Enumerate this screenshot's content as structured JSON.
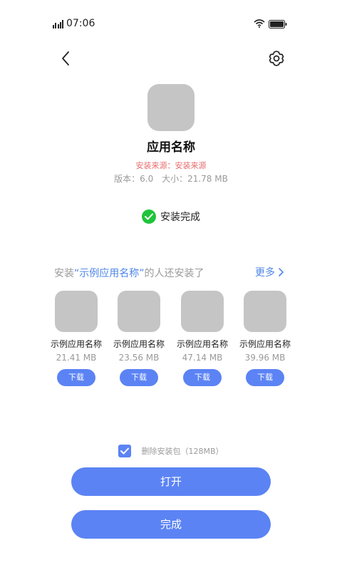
{
  "status_bar": {
    "time": "07:06"
  },
  "app": {
    "name": "应用名称",
    "install_source": "安装来源：安装来源",
    "version": "版本：6.0",
    "size": "大小：21.78 MB"
  },
  "install_status": "安装完成",
  "recommend": {
    "title_prefix": "安装",
    "title_highlight": "“示例应用名称”",
    "title_suffix": "的人还安装了",
    "more_label": "更多",
    "items": [
      {
        "name": "示例应用名称",
        "size": "21.41 MB",
        "download_label": "下载"
      },
      {
        "name": "示例应用名称",
        "size": "23.56 MB",
        "download_label": "下载"
      },
      {
        "name": "示例应用名称",
        "size": "47.14 MB",
        "download_label": "下载"
      },
      {
        "name": "示例应用名称",
        "size": "39.96 MB",
        "download_label": "下载"
      }
    ]
  },
  "delete_package": {
    "label": "删除安装包（128MB）",
    "checked": true
  },
  "buttons": {
    "open": "打开",
    "done": "完成"
  },
  "colors": {
    "accent": "#5b83f4",
    "success": "#1ec43a",
    "source": "#e86a6a"
  },
  "icons": [
    "signal-icon",
    "wifi-icon",
    "battery-icon",
    "back-arrow-icon",
    "gear-icon",
    "check-icon",
    "chevron-right-icon"
  ]
}
